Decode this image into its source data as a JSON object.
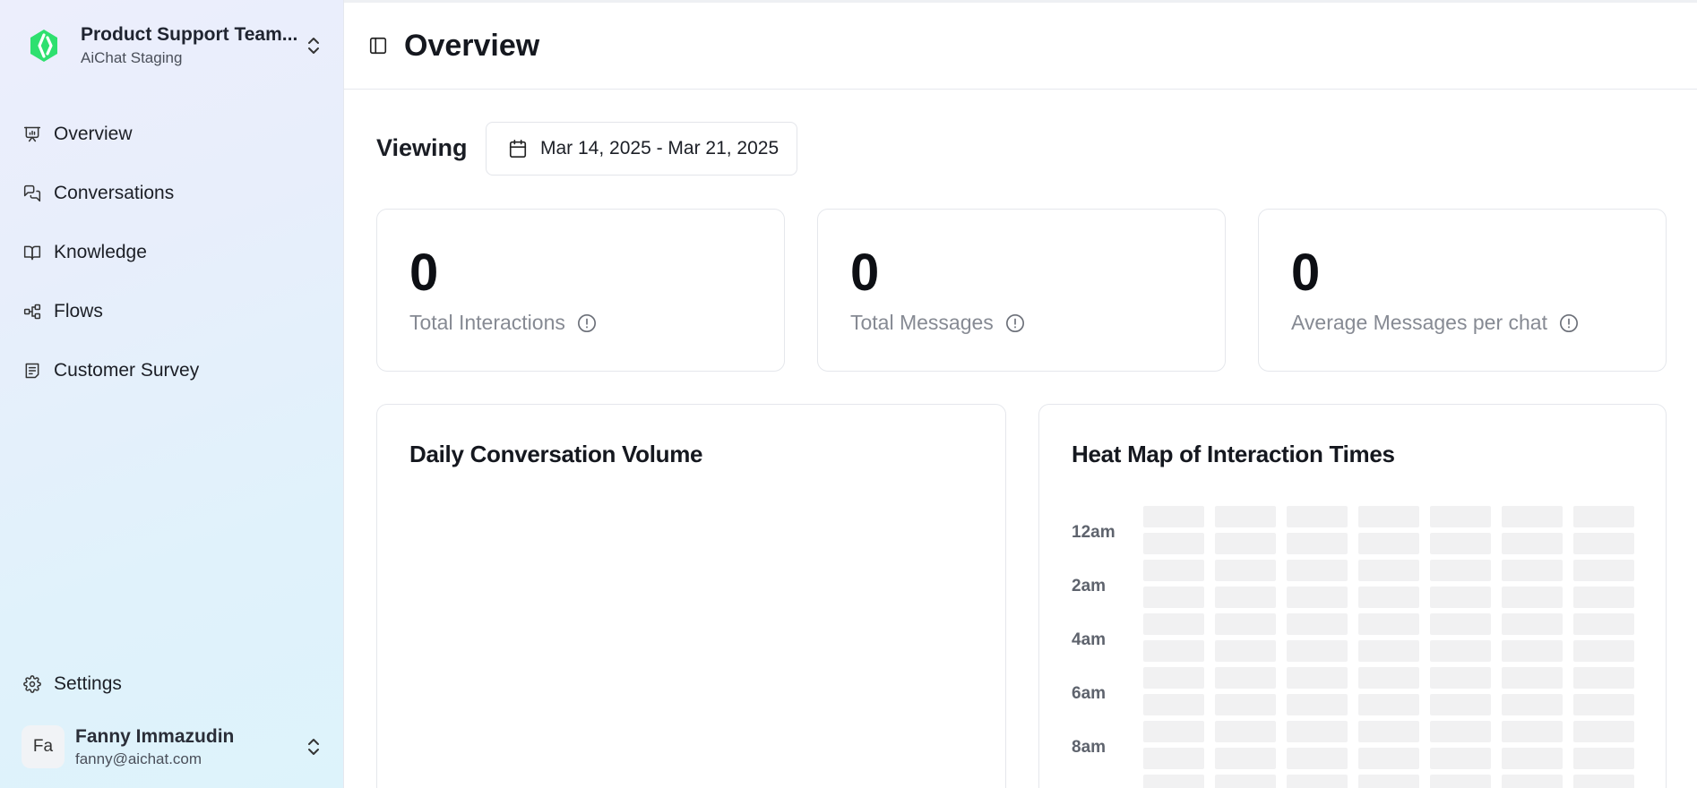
{
  "sidebar": {
    "brand": {
      "title": "Product Support Team...",
      "subtitle": "AiChat Staging",
      "accent_color": "#2ee06f"
    },
    "items": [
      {
        "label": "Overview",
        "icon": "presentation-icon"
      },
      {
        "label": "Conversations",
        "icon": "messages-icon"
      },
      {
        "label": "Knowledge",
        "icon": "book-icon"
      },
      {
        "label": "Flows",
        "icon": "workflow-icon"
      },
      {
        "label": "Customer Survey",
        "icon": "survey-icon"
      }
    ],
    "settings_label": "Settings",
    "user": {
      "initials": "Fa",
      "name": "Fanny Immazudin",
      "email": "fanny@aichat.com"
    }
  },
  "header": {
    "title": "Overview"
  },
  "filter": {
    "viewing_label": "Viewing",
    "date_range": "Mar 14, 2025 - Mar 21, 2025"
  },
  "stats": [
    {
      "value": "0",
      "label": "Total Interactions"
    },
    {
      "value": "0",
      "label": "Total Messages"
    },
    {
      "value": "0",
      "label": "Average Messages per chat"
    }
  ],
  "panels": {
    "daily_volume_title": "Daily Conversation Volume",
    "heatmap_title": "Heat Map of Interaction Times",
    "heatmap_row_labels": [
      "12am",
      "2am",
      "4am",
      "6am",
      "8am"
    ]
  }
}
